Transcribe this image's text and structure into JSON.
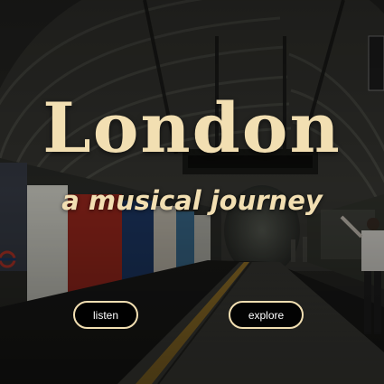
{
  "hero": {
    "title": "London",
    "subtitle": "a musical journey"
  },
  "buttons": {
    "listen_label": "listen",
    "explore_label": "explore"
  },
  "colors": {
    "title": "#f2dfb2",
    "subtitle": "#f2dfb2",
    "button_border": "#f2dfb2",
    "button_text": "#ffffff"
  }
}
